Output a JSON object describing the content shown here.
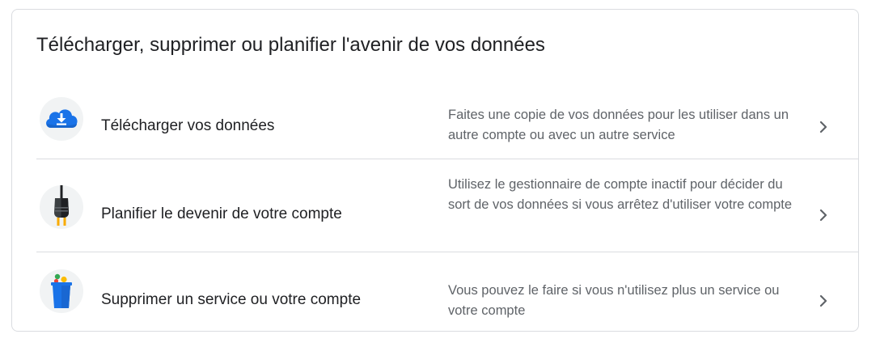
{
  "section": {
    "title": "Télécharger, supprimer ou planifier l'avenir de vos données"
  },
  "rows": [
    {
      "icon": "cloud-download-icon",
      "title": "Télécharger vos données",
      "description": "Faites une copie de vos données pour les utiliser dans un autre compte ou avec un autre service"
    },
    {
      "icon": "power-plug-icon",
      "title": "Planifier le devenir de votre compte",
      "description": "Utilisez le gestionnaire de compte inactif pour décider du sort de vos données si vous arrêtez d'utiliser votre compte"
    },
    {
      "icon": "trash-bin-icon",
      "title": "Supprimer un service ou votre compte",
      "description": "Vous pouvez le faire si vous n'utilisez plus un service ou votre compte"
    }
  ],
  "colors": {
    "title_text": "#202124",
    "secondary_text": "#5f6368",
    "divider": "#dadce0",
    "icon_blue": "#1a73e8"
  }
}
